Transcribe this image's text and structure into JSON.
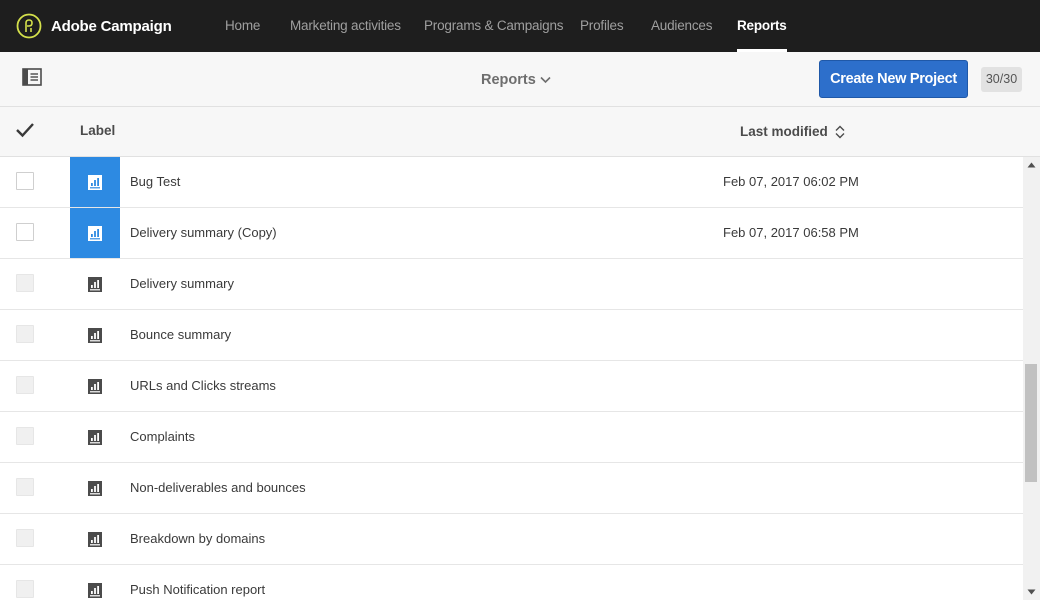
{
  "app": {
    "brand": "Adobe Campaign"
  },
  "nav": {
    "items": [
      {
        "label": "Home",
        "active": false
      },
      {
        "label": "Marketing activities",
        "active": false
      },
      {
        "label": "Programs & Campaigns",
        "active": false
      },
      {
        "label": "Profiles",
        "active": false
      },
      {
        "label": "Audiences",
        "active": false
      },
      {
        "label": "Reports",
        "active": true
      }
    ]
  },
  "actionbar": {
    "view_title": "Reports",
    "create_label": "Create New Project",
    "count": "30/30"
  },
  "table": {
    "columns": {
      "label": "Label",
      "modified": "Last modified"
    },
    "rows": [
      {
        "label": "Bug Test",
        "modified": "Feb 07, 2017 06:02 PM",
        "custom": true
      },
      {
        "label": "Delivery summary (Copy)",
        "modified": "Feb 07, 2017 06:58 PM",
        "custom": true
      },
      {
        "label": "Delivery summary",
        "modified": "",
        "custom": false
      },
      {
        "label": "Bounce summary",
        "modified": "",
        "custom": false
      },
      {
        "label": "URLs and Clicks streams",
        "modified": "",
        "custom": false
      },
      {
        "label": "Complaints",
        "modified": "",
        "custom": false
      },
      {
        "label": "Non-deliverables and bounces",
        "modified": "",
        "custom": false
      },
      {
        "label": "Breakdown by domains",
        "modified": "",
        "custom": false
      },
      {
        "label": "Push Notification report",
        "modified": "",
        "custom": false
      }
    ]
  },
  "scrollbar": {
    "position": 0.57
  },
  "colors": {
    "topbar": "#1e1e1e",
    "accent_button": "#2d6fcb",
    "custom_report_cell": "#2d8ae2"
  },
  "icons": {
    "brand": "adobe-campaign-logo-icon",
    "panel": "sidebar-panel-icon",
    "select_all": "checkmark-icon",
    "sort": "sort-icon",
    "report": "report-icon"
  }
}
